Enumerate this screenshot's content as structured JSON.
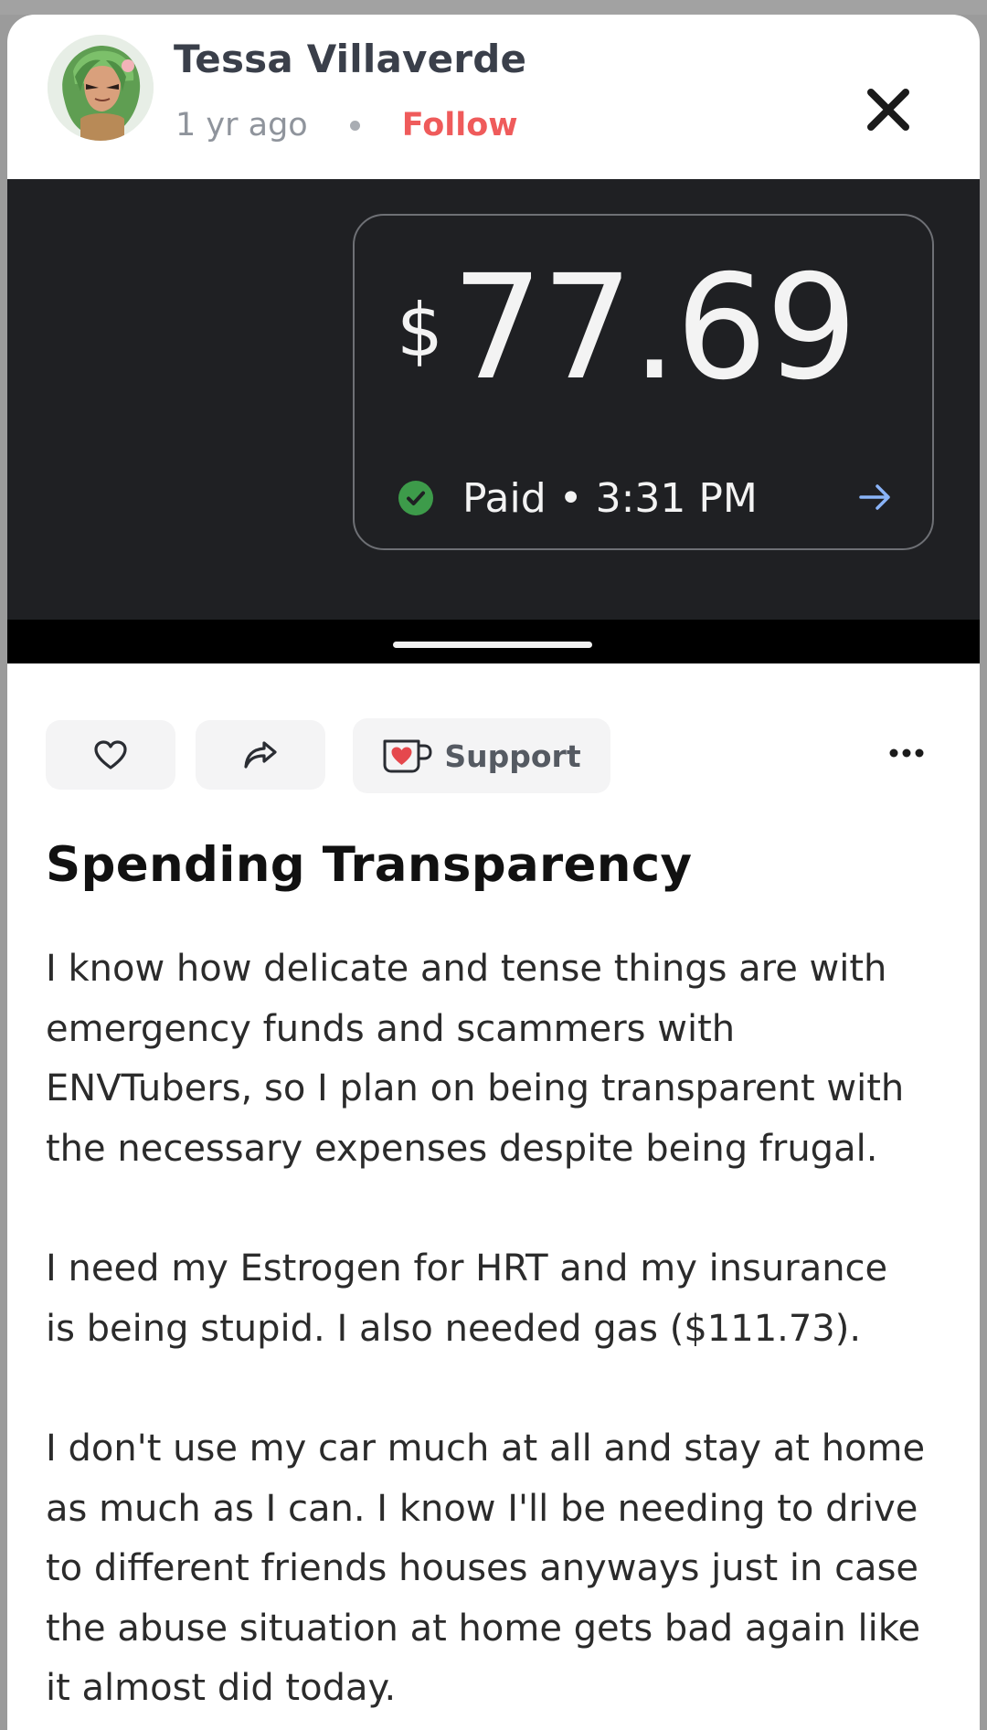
{
  "post": {
    "author": {
      "name": "Tessa Villaverde",
      "avatar_icon": "avatar-illustration"
    },
    "timestamp": "1 yr ago",
    "follow_label": "Follow",
    "close_icon": "close-icon",
    "image": {
      "currency_symbol": "$",
      "amount": "77.69",
      "status": "Paid • 3:31 PM",
      "status_icon": "check-circle-icon",
      "arrow_icon": "arrow-right-icon"
    },
    "actions": {
      "like_icon": "heart-icon",
      "share_icon": "share-icon",
      "support_label": "Support",
      "support_icon": "cup-heart-icon",
      "more_icon": "more-horizontal-icon"
    },
    "title": "Spending Transparency",
    "body": [
      [
        "I know how delicate and tense things are with",
        "emergency funds and scammers with",
        "ENVTubers, so I plan on being transparent with",
        "the necessary expenses despite being frugal."
      ],
      [
        "I need my Estrogen for HRT and my insurance",
        "is being stupid. I also needed gas ($111.73)."
      ],
      [
        "I don't use my car much at all and stay at home",
        "as much as I can. I know I'll be needing to drive",
        "to different friends houses anyways just in case",
        "the abuse situation at home gets bad again like",
        "it almost did today."
      ]
    ]
  },
  "colors": {
    "follow": "#ef5b5b",
    "image_bg": "#1f2023",
    "paid_check": "#3d9b4a",
    "arrow": "#8ab4f8",
    "heart": "#e5484d"
  }
}
